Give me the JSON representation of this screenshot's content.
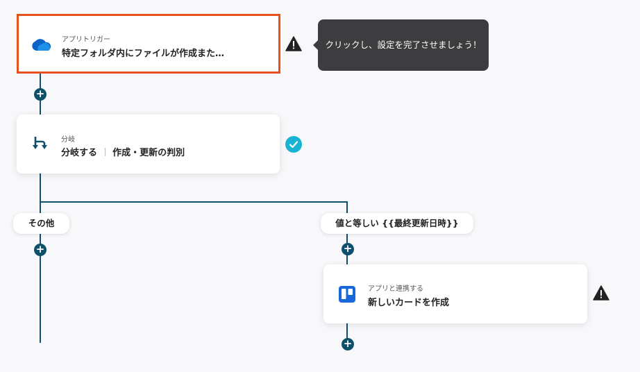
{
  "trigger": {
    "sub_label": "アプリトリガー",
    "title": "特定フォルダ内にファイルが作成また…",
    "icon": "onedrive-cloud-icon"
  },
  "tooltip": {
    "text": "クリックし、設定を完了させましょう！"
  },
  "branch": {
    "sub_label": "分岐",
    "title": "分岐する",
    "detail": "作成・更新の判別",
    "icon": "branch-icon"
  },
  "branches": {
    "left_label": "その他",
    "right_label": "値と等しい {{最終更新日時}}"
  },
  "action": {
    "sub_label": "アプリと連携する",
    "title": "新しいカードを作成",
    "icon": "trello-icon"
  },
  "plus_symbol": "+",
  "colors": {
    "connector": "#0e4f6b",
    "selected_border": "#e8501e",
    "check": "#19b4d2",
    "tooltip_bg": "#3d3d3f",
    "trello": "#1868db",
    "onedrive": "#0a64c8"
  }
}
